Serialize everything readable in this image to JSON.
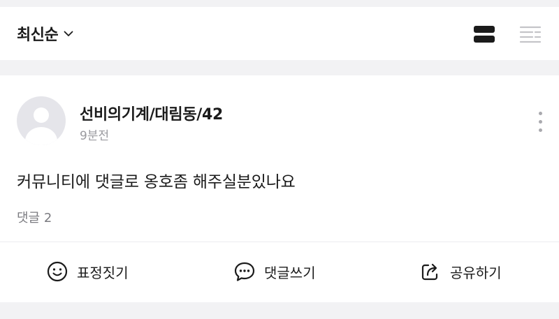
{
  "sort": {
    "label": "최신순",
    "chevron_icon": "chevron-down-icon"
  },
  "view_toggle": {
    "card_icon": "card-view-icon",
    "list_icon": "list-view-icon"
  },
  "post": {
    "author": "선비의기계/대림동/42",
    "time": "9분전",
    "content": "커뮤니티에 댓글로 옹호좀 해주실분있나요",
    "comment_count": "댓글 2"
  },
  "actions": {
    "react": {
      "label": "표정짓기",
      "icon": "smile-icon"
    },
    "comment": {
      "label": "댓글쓰기",
      "icon": "chat-bubble-icon"
    },
    "share": {
      "label": "공유하기",
      "icon": "share-icon"
    }
  },
  "colors": {
    "text": "#1b1b1b",
    "muted": "#9a9a9f",
    "background": "#f2f2f4",
    "card": "#ffffff"
  }
}
